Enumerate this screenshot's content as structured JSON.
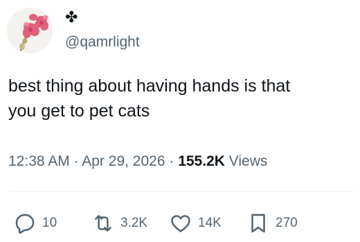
{
  "author": {
    "display_name_glyph": "✤",
    "handle": "@qamrlight"
  },
  "tweet": {
    "text_lines": [
      "best thing about having hands is that",
      "you get to pet cats"
    ]
  },
  "meta": {
    "time": "12:38 AM",
    "separator": " · ",
    "date": "Apr 29, 2026",
    "views_count": "155.2K",
    "views_label": " Views"
  },
  "actions": {
    "replies": "10",
    "retweets": "3.2K",
    "likes": "14K",
    "bookmarks": "270"
  },
  "icons": {
    "avatar": "orchid-photo",
    "reply": "reply-icon",
    "retweet": "retweet-icon",
    "like": "heart-icon",
    "bookmark": "bookmark-icon"
  },
  "colors": {
    "text_primary": "#0f1419",
    "text_secondary": "#536471",
    "divider": "#eff3f4"
  }
}
